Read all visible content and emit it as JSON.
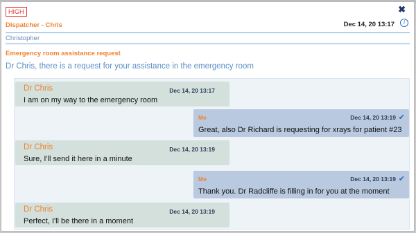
{
  "notification": {
    "priority": "HIGH",
    "sender": "Dispatcher - Chris",
    "date": "Dec 14, 20 13:17",
    "recipient": "Christopher",
    "subject": "Emergency room assistance request",
    "body": "Dr Chris, there is a request for your assistance in the emergency room"
  },
  "icons": {
    "close": "close-icon",
    "info": "info-icon",
    "read": "checkmark-icon"
  },
  "colors": {
    "accent": "#f0812d",
    "link": "#5a8ec6",
    "priority": "#e53935",
    "me_bubble": "#b9c9df",
    "them_bubble": "#d4e0dc"
  },
  "messages": [
    {
      "from": "Dr Chris",
      "time": "Dec 14, 20 13:17",
      "text": "I am on my way to the emergency room",
      "mine": false
    },
    {
      "from": "Me",
      "time": "Dec 14, 20 13:19",
      "text": "Great, also Dr Richard is requesting for xrays for patient #23",
      "mine": true
    },
    {
      "from": "Dr Chris",
      "time": "Dec 14, 20 13:19",
      "text": "Sure, I'll send it here in a minute",
      "mine": false
    },
    {
      "from": "Me",
      "time": "Dec 14, 20 13:19",
      "text": "Thank you. Dr Radcliffe is filling in for you at the moment",
      "mine": true
    },
    {
      "from": "Dr Chris",
      "time": "Dec 14, 20 13:19",
      "text": "Perfect, I'll be there in a moment",
      "mine": false
    }
  ]
}
